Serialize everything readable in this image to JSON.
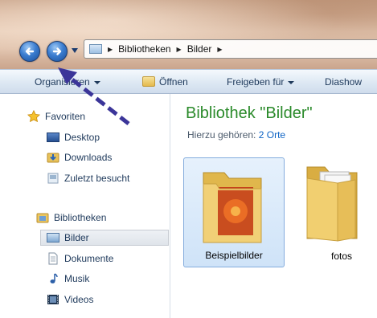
{
  "address": {
    "crumbs": [
      "Bibliotheken",
      "Bilder"
    ],
    "back_icon": "back-arrow-icon",
    "forward_icon": "forward-arrow-icon"
  },
  "toolbar": {
    "organize_label": "Organisieren",
    "open_label": "Öffnen",
    "share_label": "Freigeben für",
    "slideshow_label": "Diashow"
  },
  "sidebar": {
    "favorites_header": "Favoriten",
    "favorites": [
      {
        "label": "Desktop",
        "icon": "desktop-icon"
      },
      {
        "label": "Downloads",
        "icon": "downloads-folder-icon"
      },
      {
        "label": "Zuletzt besucht",
        "icon": "recent-places-icon"
      }
    ],
    "libraries_header": "Bibliotheken",
    "libraries": [
      {
        "label": "Bilder",
        "icon": "pictures-library-icon"
      },
      {
        "label": "Dokumente",
        "icon": "documents-library-icon"
      },
      {
        "label": "Musik",
        "icon": "music-library-icon"
      },
      {
        "label": "Videos",
        "icon": "videos-library-icon"
      }
    ]
  },
  "main": {
    "library_title": "Bibliothek \"Bilder\"",
    "includes_label": "Hierzu gehören:",
    "includes_link": "2 Orte",
    "items": [
      {
        "label": "Beispielbilder",
        "selected": true
      },
      {
        "label": "fotos",
        "selected": false
      }
    ]
  },
  "colors": {
    "accent_blue": "#1e395b",
    "title_green": "#2a8a2a",
    "arrow_annotation": "#3b3599"
  }
}
